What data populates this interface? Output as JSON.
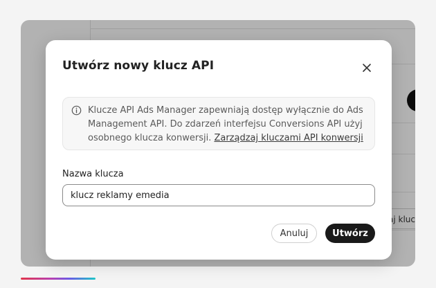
{
  "background": {
    "field_fragment": "aj kluc"
  },
  "dialog": {
    "title": "Utwórz nowy klucz API",
    "close_icon": "close-icon",
    "info": {
      "icon": "info-icon",
      "text": "Klucze API Ads Manager zapewniają dostęp wyłącznie do Ads Management API. Do zdarzeń interfejsu Conversions API użyj osobnego klucza konwersji. ",
      "link_label": "Zarządzaj kluczami API konwersji"
    },
    "key_name": {
      "label": "Nazwa klucza",
      "value": "klucz reklamy emedia"
    },
    "cancel_label": "Anuluj",
    "create_label": "Utwórz"
  },
  "colors": {
    "primary_button": "#1a1a1a",
    "overlay": "rgba(0,0,0,0.30)"
  }
}
